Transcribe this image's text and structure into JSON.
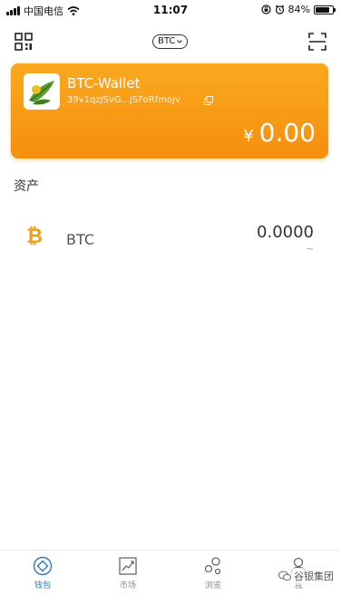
{
  "status_bar": {
    "carrier": "中国电信",
    "time": "11:07",
    "battery": "84%",
    "battery_level": 0.84
  },
  "nav": {
    "coin": "BTC"
  },
  "wallet": {
    "name": "BTC-Wallet",
    "address": "39v1qzJSvG...jSFoRfmoJv",
    "currency_symbol": "¥",
    "balance": "0.00"
  },
  "assets": {
    "title": "资产",
    "items": [
      {
        "symbol": "BTC",
        "amount": "0.0000",
        "fiat": "~",
        "icon": "bitcoin-icon"
      }
    ]
  },
  "tabs": [
    {
      "label": "钱包",
      "icon": "wallet-icon",
      "active": true
    },
    {
      "label": "市场",
      "icon": "market-chart-icon",
      "active": false
    },
    {
      "label": "浏览",
      "icon": "browse-icon",
      "active": false
    },
    {
      "label": "我",
      "icon": "profile-icon",
      "active": false
    }
  ],
  "watermark": "谷银集团",
  "colors": {
    "card_gradient_top": "#f9a91f",
    "card_gradient_bottom": "#f68f0e",
    "active_tab": "#2a78c6",
    "bitcoin": "#f39c12"
  }
}
